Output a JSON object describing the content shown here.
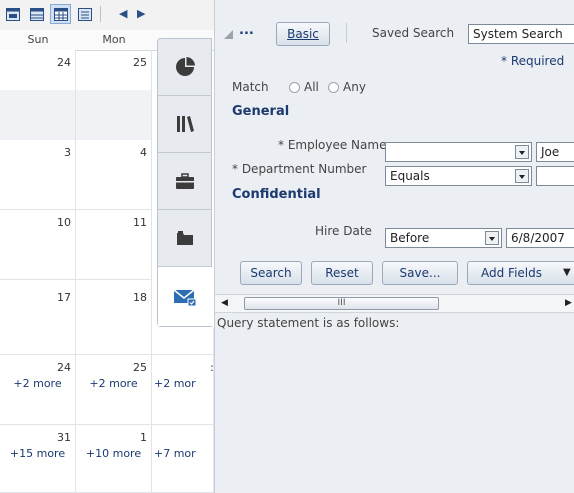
{
  "calendar": {
    "days": [
      "Sun",
      "Mon"
    ],
    "rows": [
      {
        "sun": "24",
        "mon": "25",
        "sun_more": "",
        "mon_more": "",
        "tue_more": ""
      },
      {
        "sun": "3",
        "mon": "4",
        "sun_more": "",
        "mon_more": "",
        "tue_more": ""
      },
      {
        "sun": "10",
        "mon": "11",
        "sun_more": "",
        "mon_more": "",
        "tue_more": ""
      },
      {
        "sun": "17",
        "mon": "18",
        "sun_more": "",
        "mon_more": "",
        "tue_more": ""
      },
      {
        "sun": "24",
        "mon": "25",
        "sun_more": "+2 more",
        "mon_more": "+2 more",
        "tue_more": "+2 mor"
      },
      {
        "sun": "31",
        "mon": "1",
        "sun_more": "+15 more",
        "mon_more": "+10 more",
        "tue_more": "+7 mor"
      }
    ],
    "side_tabs": [
      "pie-chart-icon",
      "library-icon",
      "briefcase-icon",
      "folder-icon",
      "mail-icon"
    ]
  },
  "search": {
    "ellipsis": "...",
    "basic_button": "Basic",
    "saved_search_label": "Saved Search",
    "saved_search_value": "System Search",
    "required_note": "* Required",
    "match_label": "Match",
    "match_all": "All",
    "match_any": "Any",
    "general_header": "General",
    "employee_name_label": "* Employee Name",
    "employee_name_value": "",
    "employee_name_text": "Joe",
    "department_label": "* Department Number",
    "department_operator": "Equals",
    "confidential_header": "Confidential",
    "hire_date_label": "Hire Date",
    "hire_date_operator": "Before",
    "hire_date_value": "6/8/2007",
    "buttons": {
      "search": "Search",
      "reset": "Reset",
      "save": "Save...",
      "add_fields": "Add Fields"
    },
    "scroll_thumb_mark": "III",
    "query_statement": "Query statement is as follows:"
  }
}
